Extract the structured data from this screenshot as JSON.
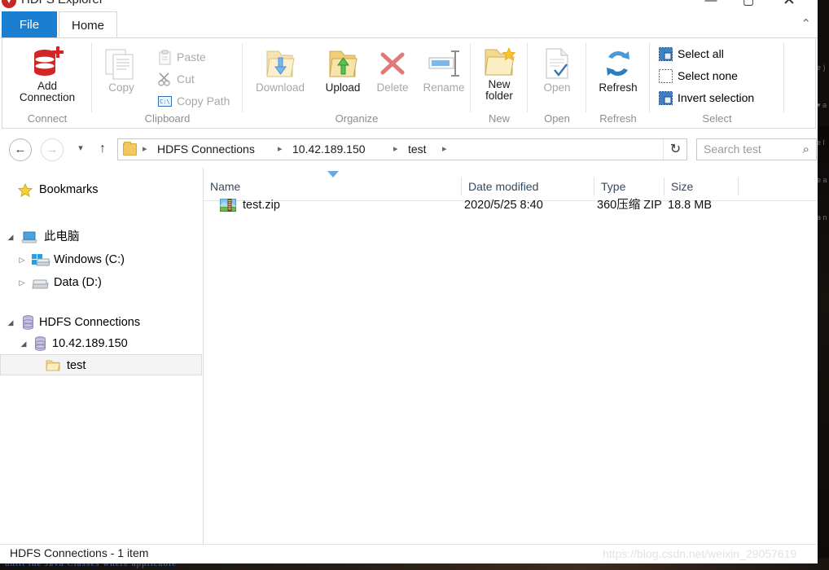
{
  "window": {
    "title": "HDFS Explorer",
    "minimize": "—",
    "maximize": "▢",
    "close": "✕",
    "collapse_ribbon": "⌃"
  },
  "tabs": [
    {
      "label": "File",
      "active": false
    },
    {
      "label": "Home",
      "active": true
    }
  ],
  "ribbon": {
    "groups": [
      {
        "name": "Connect",
        "items": [
          {
            "label": "Add\nConnection",
            "label_line1": "Add",
            "label_line2": "Connection",
            "icon": "database-plus-icon",
            "enabled": true
          }
        ]
      },
      {
        "name": "Clipboard",
        "items": [
          {
            "label": "Copy",
            "icon": "copy-icon",
            "enabled": false
          },
          {
            "label": "Paste",
            "icon": "paste-icon",
            "enabled": false
          },
          {
            "label": "Cut",
            "icon": "scissors-icon",
            "enabled": false
          },
          {
            "label": "Copy Path",
            "icon": "copy-path-icon",
            "enabled": false
          }
        ]
      },
      {
        "name": "Organize",
        "items": [
          {
            "label": "Download",
            "icon": "folder-download-icon",
            "enabled": false
          },
          {
            "label": "Upload",
            "icon": "folder-upload-icon",
            "enabled": true
          },
          {
            "label": "Delete",
            "icon": "red-x-icon",
            "enabled": false
          },
          {
            "label": "Rename",
            "icon": "rename-icon",
            "enabled": false
          }
        ]
      },
      {
        "name": "New",
        "items": [
          {
            "label_line1": "New",
            "label_line2": "folder",
            "icon": "new-folder-icon",
            "enabled": true
          }
        ]
      },
      {
        "name": "Open",
        "items": [
          {
            "label": "Open",
            "icon": "open-document-icon",
            "enabled": false
          }
        ]
      },
      {
        "name": "Refresh",
        "items": [
          {
            "label": "Refresh",
            "icon": "refresh-icon",
            "enabled": true
          }
        ]
      },
      {
        "name": "Select",
        "items": [
          {
            "label": "Select all",
            "icon": "select-all-icon",
            "enabled": true
          },
          {
            "label": "Select none",
            "icon": "select-none-icon",
            "enabled": true
          },
          {
            "label": "Invert selection",
            "icon": "invert-selection-icon",
            "enabled": true
          }
        ]
      }
    ]
  },
  "nav": {
    "back": "←",
    "forward": "→",
    "recent": "▾",
    "up": "↑",
    "refresh": "↻",
    "breadcrumbs": [
      "HDFS Connections",
      "10.42.189.150",
      "test"
    ],
    "separator": "▸"
  },
  "search": {
    "placeholder": "Search test",
    "value": "",
    "icon": "search-icon"
  },
  "tree": {
    "nodes": [
      {
        "label": "Bookmarks",
        "icon": "star-icon",
        "indent": 0,
        "expander": "",
        "selected": false
      },
      {
        "label": "此电脑",
        "icon": "this-pc-icon",
        "indent": 0,
        "expander": "◢",
        "selected": false
      },
      {
        "label": "Windows (C:)",
        "icon": "windows-drive-icon",
        "indent": 1,
        "expander": "▷",
        "selected": false
      },
      {
        "label": "Data (D:)",
        "icon": "drive-icon",
        "indent": 1,
        "expander": "▷",
        "selected": false
      },
      {
        "label": "HDFS Connections",
        "icon": "database-icon",
        "indent": 0,
        "expander": "◢",
        "selected": false
      },
      {
        "label": "10.42.189.150",
        "icon": "database-icon",
        "indent": 1,
        "expander": "◢",
        "selected": false
      },
      {
        "label": "test",
        "icon": "folder-icon",
        "indent": 2,
        "expander": "",
        "selected": true
      }
    ]
  },
  "filelist": {
    "columns": [
      "Name",
      "Date modified",
      "Type",
      "Size"
    ],
    "sort_column": "Name",
    "sort_direction": "descending",
    "rows": [
      {
        "name": "test.zip",
        "date_modified": "2020/5/25 8:40",
        "type": "360压缩 ZIP",
        "size": "18.8 MB",
        "icon": "zip-archive-icon"
      }
    ]
  },
  "status": {
    "text": "HDFS Connections - 1 item"
  },
  "watermark": {
    "text": "https://blog.csdn.net/weixin_29057619"
  },
  "backdrop": {
    "bottom_text": "until the Java Classes where applicable"
  },
  "colors": {
    "file_tab_blue": "#1b7fd1",
    "accent_red": "#d42525",
    "sort_marker_blue": "#6aaae0",
    "header_text": "#34495e",
    "disabled_text": "#a8a8a8"
  }
}
